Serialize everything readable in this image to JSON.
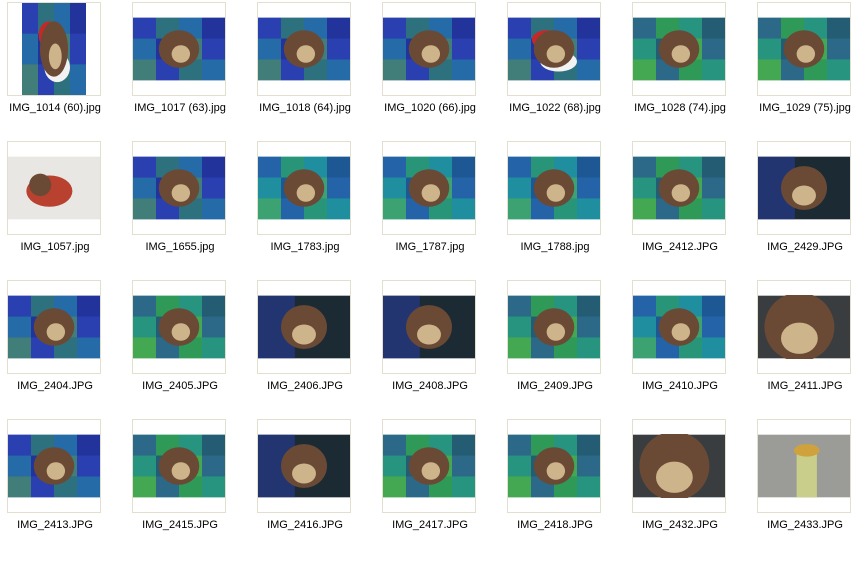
{
  "window": {
    "view": "thumbnails"
  },
  "colors": {
    "frame_border": "#e3dfcf",
    "blanket_blue": "#2a3fb0",
    "blanket_green": "#2f9a57",
    "blanket_teal": "#1f8fa0",
    "plush_brown": "#6a4a34",
    "plush_tan": "#cdb48a",
    "sheet_white": "#e9e7e3",
    "dark_bg": "#1c2a33"
  },
  "files": [
    {
      "name": "IMG_1014 (60).jpg",
      "orientation": "portrait",
      "scene": "blanket-xmas"
    },
    {
      "name": "IMG_1017 (63).jpg",
      "orientation": "landscape",
      "scene": "blanket-blue"
    },
    {
      "name": "IMG_1018 (64).jpg",
      "orientation": "landscape",
      "scene": "blanket-blue"
    },
    {
      "name": "IMG_1020 (66).jpg",
      "orientation": "landscape",
      "scene": "blanket-blue"
    },
    {
      "name": "IMG_1022 (68).jpg",
      "orientation": "landscape",
      "scene": "blanket-xmas"
    },
    {
      "name": "IMG_1028 (74).jpg",
      "orientation": "landscape",
      "scene": "blanket-green"
    },
    {
      "name": "IMG_1029 (75).jpg",
      "orientation": "landscape",
      "scene": "blanket-green"
    },
    {
      "name": "IMG_1057.jpg",
      "orientation": "landscape",
      "scene": "sheet"
    },
    {
      "name": "IMG_1655.jpg",
      "orientation": "landscape",
      "scene": "blanket-blue"
    },
    {
      "name": "IMG_1783.jpg",
      "orientation": "landscape",
      "scene": "blanket-teal"
    },
    {
      "name": "IMG_1787.jpg",
      "orientation": "landscape",
      "scene": "blanket-teal"
    },
    {
      "name": "IMG_1788.jpg",
      "orientation": "landscape",
      "scene": "blanket-teal"
    },
    {
      "name": "IMG_2412.JPG",
      "orientation": "landscape",
      "scene": "blanket-green"
    },
    {
      "name": "IMG_2429.JPG",
      "orientation": "landscape",
      "scene": "dark"
    },
    {
      "name": "IMG_2404.JPG",
      "orientation": "landscape",
      "scene": "blanket-blue"
    },
    {
      "name": "IMG_2405.JPG",
      "orientation": "landscape",
      "scene": "blanket-green"
    },
    {
      "name": "IMG_2406.JPG",
      "orientation": "landscape",
      "scene": "dark"
    },
    {
      "name": "IMG_2408.JPG",
      "orientation": "landscape",
      "scene": "dark"
    },
    {
      "name": "IMG_2409.JPG",
      "orientation": "landscape",
      "scene": "blanket-green"
    },
    {
      "name": "IMG_2410.JPG",
      "orientation": "landscape",
      "scene": "blanket-teal"
    },
    {
      "name": "IMG_2411.JPG",
      "orientation": "landscape",
      "scene": "closeup"
    },
    {
      "name": "IMG_2413.JPG",
      "orientation": "landscape",
      "scene": "blanket-blue"
    },
    {
      "name": "IMG_2415.JPG",
      "orientation": "landscape",
      "scene": "blanket-green"
    },
    {
      "name": "IMG_2416.JPG",
      "orientation": "landscape",
      "scene": "dark"
    },
    {
      "name": "IMG_2417.JPG",
      "orientation": "landscape",
      "scene": "blanket-green"
    },
    {
      "name": "IMG_2418.JPG",
      "orientation": "landscape",
      "scene": "blanket-green"
    },
    {
      "name": "IMG_2432.JPG",
      "orientation": "landscape",
      "scene": "closeup"
    },
    {
      "name": "IMG_2433.JPG",
      "orientation": "landscape",
      "scene": "grey"
    }
  ]
}
